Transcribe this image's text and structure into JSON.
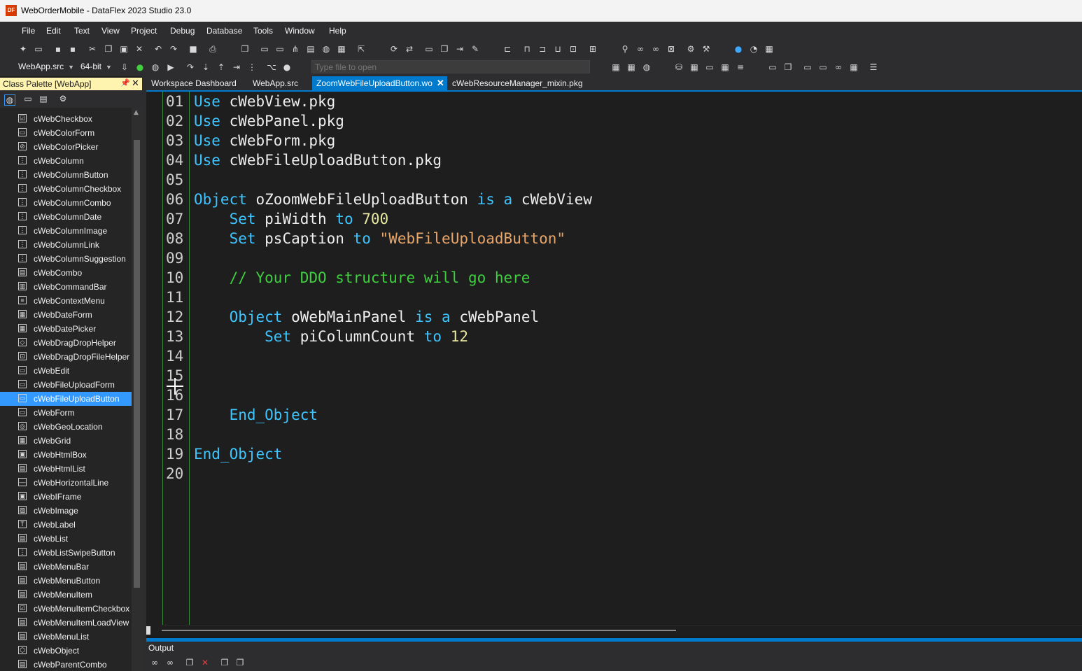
{
  "window": {
    "title": "WebOrderMobile - DataFlex 2023 Studio 23.0",
    "app_icon": "DF"
  },
  "menu": [
    "File",
    "Edit",
    "Text",
    "View",
    "Project",
    "Debug",
    "Database",
    "Tools",
    "Window",
    "Help"
  ],
  "toolbar": {
    "project_combo": "WebApp.src",
    "bitness_combo": "64-bit",
    "file_open_placeholder": "Type file to open"
  },
  "palette": {
    "title": "Class Palette [WebApp]",
    "pin_icon": "📌",
    "close_icon": "✕",
    "selected": "cWebFileUploadButton",
    "items": [
      "cWebCheckbox",
      "cWebColorForm",
      "cWebColorPicker",
      "cWebColumn",
      "cWebColumnButton",
      "cWebColumnCheckbox",
      "cWebColumnCombo",
      "cWebColumnDate",
      "cWebColumnImage",
      "cWebColumnLink",
      "cWebColumnSuggestion",
      "cWebCombo",
      "cWebCommandBar",
      "cWebContextMenu",
      "cWebDateForm",
      "cWebDatePicker",
      "cWebDragDropHelper",
      "cWebDragDropFileHelper",
      "cWebEdit",
      "cWebFileUploadForm",
      "cWebFileUploadButton",
      "cWebForm",
      "cWebGeoLocation",
      "cWebGrid",
      "cWebHtmlBox",
      "cWebHtmlList",
      "cWebHorizontalLine",
      "cWebIFrame",
      "cWebImage",
      "cWebLabel",
      "cWebList",
      "cWebListSwipeButton",
      "cWebMenuBar",
      "cWebMenuButton",
      "cWebMenuItem",
      "cWebMenuItemCheckbox",
      "cWebMenuItemLoadView",
      "cWebMenuList",
      "cWebObject",
      "cWebParentCombo"
    ]
  },
  "tabs": [
    {
      "label": "Workspace Dashboard",
      "active": false
    },
    {
      "label": "WebApp.src",
      "active": false
    },
    {
      "label": "ZoomWebFileUploadButton.wo",
      "active": true,
      "close": "✕"
    },
    {
      "label": "cWebResourceManager_mixin.pkg",
      "active": false
    }
  ],
  "editor": {
    "line_numbers": [
      "01",
      "02",
      "03",
      "04",
      "05",
      "06",
      "07",
      "08",
      "09",
      "10",
      "11",
      "12",
      "13",
      "14",
      "15",
      "16",
      "17",
      "18",
      "19",
      "20"
    ],
    "lines": [
      {
        "indent": "",
        "tokens": [
          {
            "t": "Use",
            "c": "kw"
          },
          {
            "t": " cWebView.pkg",
            "c": ""
          }
        ]
      },
      {
        "indent": "",
        "tokens": [
          {
            "t": "Use",
            "c": "kw"
          },
          {
            "t": " cWebPanel.pkg",
            "c": ""
          }
        ]
      },
      {
        "indent": "",
        "tokens": [
          {
            "t": "Use",
            "c": "kw"
          },
          {
            "t": " cWebForm.pkg",
            "c": ""
          }
        ]
      },
      {
        "indent": "",
        "tokens": [
          {
            "t": "Use",
            "c": "kw"
          },
          {
            "t": " cWebFileUploadButton.pkg",
            "c": ""
          }
        ]
      },
      {
        "indent": "",
        "tokens": []
      },
      {
        "indent": "",
        "tokens": [
          {
            "t": "Object",
            "c": "kw"
          },
          {
            "t": " oZoomWebFileUploadButton ",
            "c": ""
          },
          {
            "t": "is a",
            "c": "kw"
          },
          {
            "t": " cWebView",
            "c": ""
          }
        ]
      },
      {
        "indent": "    ",
        "tokens": [
          {
            "t": "Set",
            "c": "kw"
          },
          {
            "t": " piWidth ",
            "c": ""
          },
          {
            "t": "to",
            "c": "kw"
          },
          {
            "t": " ",
            "c": ""
          },
          {
            "t": "700",
            "c": "num"
          }
        ]
      },
      {
        "indent": "    ",
        "tokens": [
          {
            "t": "Set",
            "c": "kw"
          },
          {
            "t": " psCaption ",
            "c": ""
          },
          {
            "t": "to",
            "c": "kw"
          },
          {
            "t": " ",
            "c": ""
          },
          {
            "t": "\"WebFileUploadButton\"",
            "c": "str"
          }
        ]
      },
      {
        "indent": "",
        "tokens": []
      },
      {
        "indent": "    ",
        "tokens": [
          {
            "t": "// Your DDO structure will go here",
            "c": "cmt"
          }
        ]
      },
      {
        "indent": "",
        "tokens": []
      },
      {
        "indent": "    ",
        "tokens": [
          {
            "t": "Object",
            "c": "kw"
          },
          {
            "t": " oWebMainPanel ",
            "c": ""
          },
          {
            "t": "is a",
            "c": "kw"
          },
          {
            "t": " cWebPanel",
            "c": ""
          }
        ]
      },
      {
        "indent": "        ",
        "tokens": [
          {
            "t": "Set",
            "c": "kw"
          },
          {
            "t": " piColumnCount ",
            "c": ""
          },
          {
            "t": "to",
            "c": "kw"
          },
          {
            "t": " ",
            "c": ""
          },
          {
            "t": "12",
            "c": "num"
          }
        ]
      },
      {
        "indent": "",
        "tokens": []
      },
      {
        "indent": "",
        "tokens": []
      },
      {
        "indent": "",
        "tokens": []
      },
      {
        "indent": "    ",
        "tokens": [
          {
            "t": "End_Object",
            "c": "kw"
          }
        ]
      },
      {
        "indent": "",
        "tokens": []
      },
      {
        "indent": "",
        "tokens": [
          {
            "t": "End_Object",
            "c": "kw"
          }
        ]
      },
      {
        "indent": "",
        "tokens": []
      }
    ]
  },
  "output": {
    "title": "Output"
  }
}
